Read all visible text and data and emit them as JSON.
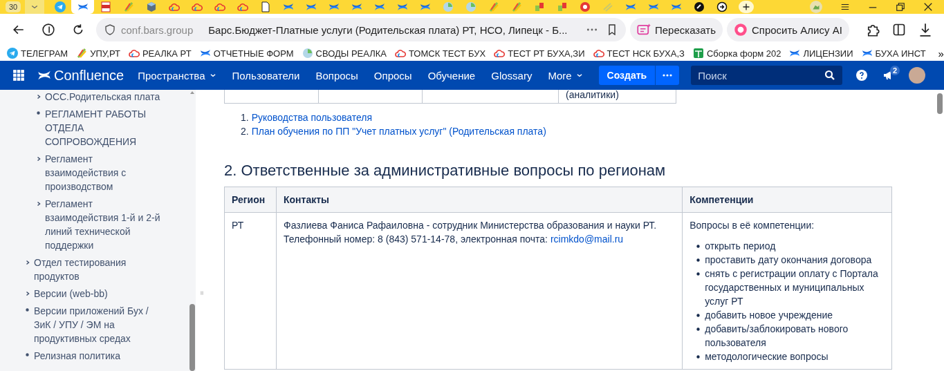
{
  "browser": {
    "tab_count": "30",
    "tabs": [
      {
        "kind": "telegram",
        "selected": false
      },
      {
        "kind": "confluence",
        "selected": true
      },
      {
        "kind": "pdf",
        "selected": false
      },
      {
        "kind": "leaf",
        "selected": false
      },
      {
        "kind": "cube",
        "selected": false
      },
      {
        "kind": "cloud",
        "selected": false
      },
      {
        "kind": "cloud",
        "selected": false
      },
      {
        "kind": "cloud",
        "selected": false
      },
      {
        "kind": "cloud",
        "selected": false
      },
      {
        "kind": "page",
        "selected": false
      },
      {
        "kind": "confluence",
        "selected": false
      },
      {
        "kind": "confluence",
        "selected": false
      },
      {
        "kind": "confluence",
        "selected": false
      },
      {
        "kind": "confluence",
        "selected": false
      },
      {
        "kind": "confluence",
        "selected": false
      },
      {
        "kind": "confluence",
        "selected": false
      },
      {
        "kind": "confluence",
        "selected": false
      },
      {
        "kind": "globe",
        "selected": false
      },
      {
        "kind": "globe",
        "selected": false
      },
      {
        "kind": "leaf",
        "selected": false
      },
      {
        "kind": "leaf",
        "selected": false
      },
      {
        "kind": "boxes",
        "selected": false
      },
      {
        "kind": "boxes",
        "selected": false
      },
      {
        "kind": "redcircle",
        "selected": false
      },
      {
        "kind": "stripes",
        "selected": false
      },
      {
        "kind": "confluence",
        "selected": false
      },
      {
        "kind": "confluence",
        "selected": false
      },
      {
        "kind": "confluence",
        "selected": false
      },
      {
        "kind": "blackcircle",
        "selected": false
      },
      {
        "kind": "arrowcircle",
        "selected": false
      }
    ],
    "address": {
      "domain": "conf.bars.group",
      "page_title": "Барс.Бюджет-Платные услуги (Родительская плата) РТ, НСО, Липецк - Б..."
    },
    "actions": [
      {
        "kind": "retell",
        "label": "Пересказать"
      },
      {
        "kind": "alice",
        "label": "Спросить Алису AI"
      }
    ],
    "bookmarks": [
      {
        "kind": "telegram",
        "label": "ТЕЛЕГРАМ"
      },
      {
        "kind": "leaf",
        "label": "УПУ,РТ"
      },
      {
        "kind": "cloud",
        "label": "РЕАЛКА РТ"
      },
      {
        "kind": "confluence",
        "label": "ОТЧЕТНЫЕ ФОРМ"
      },
      {
        "kind": "globe",
        "label": "СВОДЫ РЕАЛКА"
      },
      {
        "kind": "cloud",
        "label": "ТОМСК ТЕСТ БУХ"
      },
      {
        "kind": "cloud",
        "label": "ТЕСТ РТ БУХА,ЗИ"
      },
      {
        "kind": "cloud",
        "label": "ТЕСТ НСК БУХА,З"
      },
      {
        "kind": "sheet",
        "label": "Сборка форм 202"
      },
      {
        "kind": "confluence",
        "label": "ЛИЦЕНЗИИ"
      },
      {
        "kind": "confluence",
        "label": "БУХА ИНСТ"
      }
    ],
    "bookmarks_more": "»"
  },
  "app": {
    "logo": "Confluence",
    "nav": [
      {
        "label": "Пространства",
        "dropdown": true
      },
      {
        "label": "Пользователи",
        "dropdown": false
      },
      {
        "label": "Вопросы",
        "dropdown": false
      },
      {
        "label": "Опросы",
        "dropdown": false
      },
      {
        "label": "Обучение",
        "dropdown": false
      },
      {
        "label": "Glossary",
        "dropdown": false
      },
      {
        "label": "More",
        "dropdown": true
      }
    ],
    "create": "Создать",
    "search": {
      "placeholder": "Поиск"
    },
    "notifications": "2"
  },
  "sidebar": {
    "items": [
      {
        "children": [
          {
            "kind": "expandable",
            "expanded": false,
            "label": "ОСС.Родительская плата"
          },
          {
            "kind": "leaf",
            "label": "РЕГЛАМЕНТ РАБОТЫ ОТДЕЛА СОПРОВОЖДЕНИЯ"
          },
          {
            "kind": "expandable",
            "expanded": false,
            "label": "Регламент взаимодействия с производством"
          },
          {
            "kind": "expandable",
            "expanded": false,
            "label": "Регламент взаимодействия 1-й и 2-й линий технической поддержки"
          }
        ]
      },
      {
        "kind": "expandable",
        "expanded": false,
        "label": "Отдел тестирования продуктов"
      },
      {
        "kind": "expandable",
        "expanded": false,
        "label": "Версии (web-bb)"
      },
      {
        "kind": "leaf",
        "label": "Версии приложений Бух / ЗиК / УПУ / ЭМ на продуктивных средах"
      },
      {
        "kind": "leaf",
        "label": "Релизная политика"
      }
    ]
  },
  "page": {
    "previous_table": {
      "column_4": "(аналитики)"
    },
    "links": [
      {
        "number": "1.",
        "label": "Руководства пользователя"
      },
      {
        "number": "2.",
        "label": "План обучения по ПП \"Учет платных услуг\" (Родительская плата)"
      }
    ],
    "heading": "2. Ответственные за административные вопросы по регионам",
    "table": {
      "columns": [
        "Регион",
        "Контакты",
        "Компетенции"
      ],
      "rows": [
        {
          "region": "РТ",
          "contact": {
            "text": "Фазлиева Фаниса Рафаиловна -  сотрудник Министерства образования и науки РТ. Телефонный номер: 8 (843) 571-14-78, электронная почта: ",
            "email": "rcimkdo@mail.ru"
          },
          "competence": {
            "intro": "Вопросы в её компетенции:",
            "items": [
              "открыть период",
              "проставить дату окончания договора",
              "снять с регистрации оплату с Портала государственных и муниципальных услуг РТ",
              "добавить новое учреждение",
              "добавить/заблокировать нового пользователя",
              "методологические вопросы"
            ]
          }
        }
      ]
    }
  }
}
